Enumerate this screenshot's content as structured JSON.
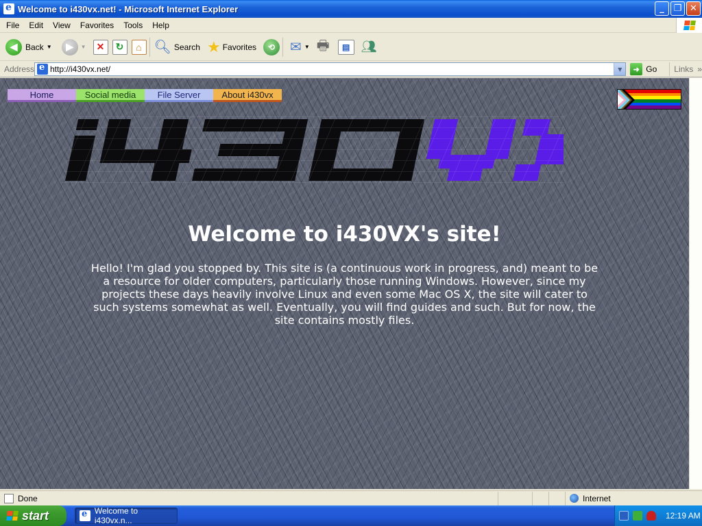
{
  "window": {
    "title": "Welcome to i430vx.net! - Microsoft Internet Explorer",
    "buttons": {
      "minimize": "_",
      "maximize": "❐",
      "close": "✕"
    }
  },
  "menu": [
    "File",
    "Edit",
    "View",
    "Favorites",
    "Tools",
    "Help"
  ],
  "toolbar": {
    "back_label": "Back",
    "search_label": "Search",
    "favorites_label": "Favorites"
  },
  "address": {
    "label": "Address",
    "url": "http://i430vx.net/",
    "go_label": "Go",
    "links_label": "Links"
  },
  "page": {
    "nav": [
      "Home",
      "Social media",
      "File Server",
      "About i430vx"
    ],
    "logo_text_dark": "i430",
    "logo_text_accent": "VX",
    "heading": "Welcome to i430VX's site!",
    "intro": "Hello! I'm glad you stopped by. This site is (a continuous work in progress, and) meant to be a resource for older computers, particularly those running Windows. However, since my projects these days heavily involve Linux and even some Mac OS X, the site will cater to such systems somewhat as well. Eventually, you will find guides and such. But for now, the site contains mostly files."
  },
  "status": {
    "text": "Done",
    "zone": "Internet"
  },
  "taskbar": {
    "start_label": "start",
    "task_label": "Welcome to i430vx.n...",
    "clock": "12:19 AM"
  },
  "colors": {
    "logo_accent": "#5a1de8",
    "logo_dark": "#0b0b0e",
    "page_background": "#5c6171"
  }
}
